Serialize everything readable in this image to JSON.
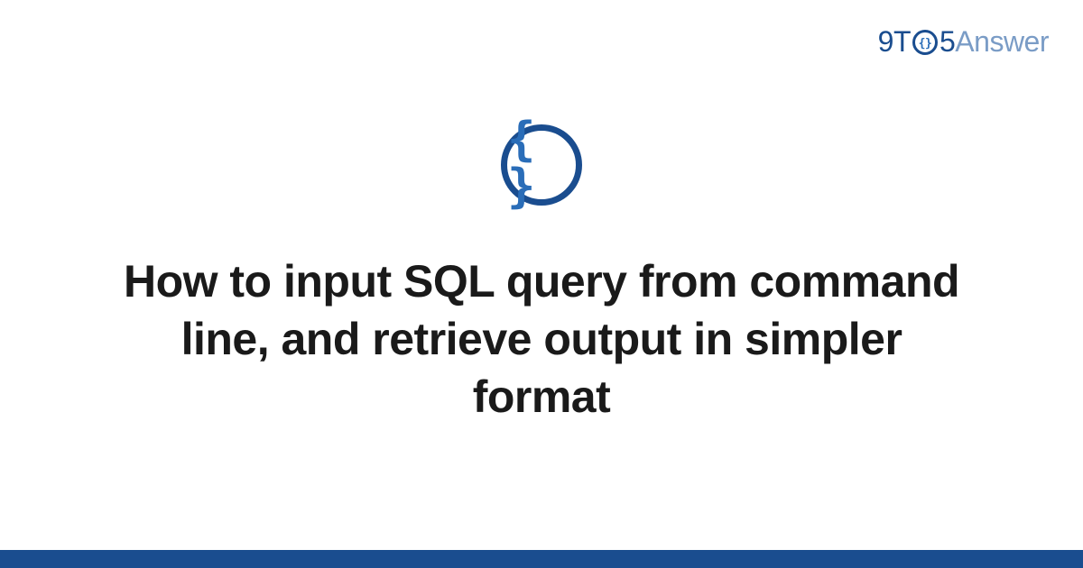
{
  "logo": {
    "prefix": "9T",
    "middle_icon": "braces-circle-icon",
    "suffix": "5",
    "word": "Answer"
  },
  "icon": {
    "symbol": "{ }",
    "name": "code-braces-icon"
  },
  "title": "How to input SQL query from command line, and retrieve output in simpler format",
  "colors": {
    "primary": "#1a4d8f",
    "secondary": "#7a9cc6",
    "accent": "#2a6db8",
    "text": "#1a1a1a",
    "background": "#ffffff"
  }
}
